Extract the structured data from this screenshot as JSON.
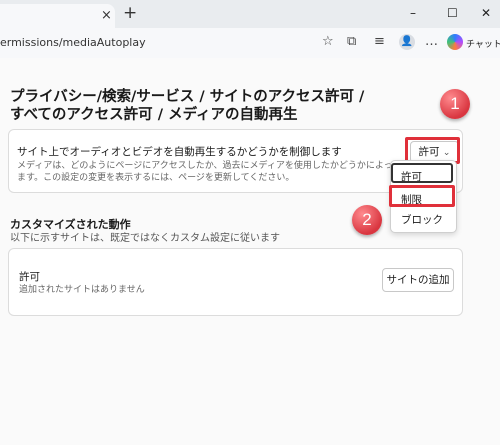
{
  "browser": {
    "tab_close": "×",
    "new_tab": "+",
    "window_controls": {
      "minimize": "–",
      "maximize": "☐",
      "close": "✕"
    },
    "url": "ermissions/mediaAutoplay",
    "toolbar": {
      "favorite": "☆",
      "extensions": "⧉",
      "collections": "≡",
      "profile": "👤",
      "more": "…"
    },
    "chat_label": "チャット"
  },
  "page": {
    "heading_line1": "プライバシー/検索/サービス / サイトのアクセス許可 /",
    "heading_line2": "すべてのアクセス許可 / メディアの自動再生",
    "autoplay_card": {
      "title": "サイト上でオーディオとビデオを自動再生するかどうかを制御します",
      "desc_line1": "メディアは、どのようにページにアクセスしたか、過去にメディアを使用したかどうかによって再生さ",
      "desc_line2": "ます。この設定の変更を表示するには、ページを更新してください。",
      "dropdown_value": "許可",
      "dropdown_chevron": "⌄"
    },
    "dropdown_menu": {
      "items": [
        "許可",
        "制限",
        "ブロック"
      ]
    },
    "custom_section": {
      "title": "カスタマイズされた動作",
      "desc": "以下に示すサイトは、既定ではなくカスタム設定に従います"
    },
    "allow_card": {
      "title": "許可",
      "desc": "追加されたサイトはありません",
      "add_button": "サイトの追加"
    }
  },
  "annotations": {
    "badge1": "1",
    "badge2": "2",
    "highlight_color": "#e0303a"
  }
}
